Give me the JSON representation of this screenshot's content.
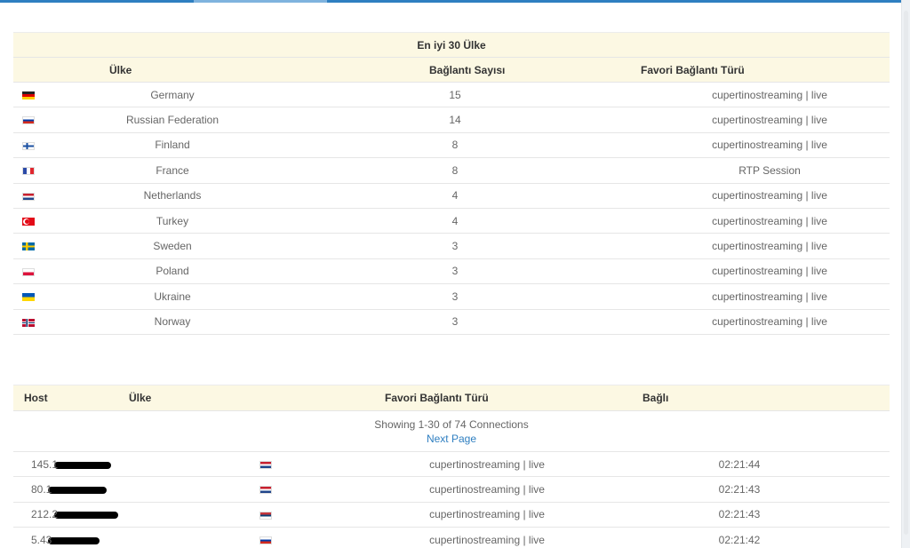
{
  "top_countries": {
    "caption": "En iyi 30 Ülke",
    "headers": {
      "country": "Ülke",
      "count": "Bağlantı Sayısı",
      "type": "Favori Bağlantı Türü"
    },
    "rows": [
      {
        "flag": "flag-germany-icon",
        "country": "Germany",
        "count": "15",
        "type": "cupertinostreaming | live"
      },
      {
        "flag": "flag-russia-icon",
        "country": "Russian Federation",
        "count": "14",
        "type": "cupertinostreaming | live"
      },
      {
        "flag": "flag-finland-icon",
        "country": "Finland",
        "count": "8",
        "type": "cupertinostreaming | live"
      },
      {
        "flag": "flag-france-icon",
        "country": "France",
        "count": "8",
        "type": "RTP Session"
      },
      {
        "flag": "flag-netherlands-icon",
        "country": "Netherlands",
        "count": "4",
        "type": "cupertinostreaming | live"
      },
      {
        "flag": "flag-turkey-icon",
        "country": "Turkey",
        "count": "4",
        "type": "cupertinostreaming | live"
      },
      {
        "flag": "flag-sweden-icon",
        "country": "Sweden",
        "count": "3",
        "type": "cupertinostreaming | live"
      },
      {
        "flag": "flag-poland-icon",
        "country": "Poland",
        "count": "3",
        "type": "cupertinostreaming | live"
      },
      {
        "flag": "flag-ukraine-icon",
        "country": "Ukraine",
        "count": "3",
        "type": "cupertinostreaming | live"
      },
      {
        "flag": "flag-norway-icon",
        "country": "Norway",
        "count": "3",
        "type": "cupertinostreaming | live"
      }
    ]
  },
  "connections": {
    "headers": {
      "host": "Host",
      "country": "Ülke",
      "type": "Favori Bağlantı Türü",
      "connected": "Bağlı"
    },
    "pager": {
      "showing": "Showing 1-30 of 74 Connections",
      "next": "Next Page"
    },
    "rows": [
      {
        "host": "145.1",
        "flag": "flag-netherlands-icon",
        "type": "cupertinostreaming | live",
        "connected": "02:21:44"
      },
      {
        "host": "80.1",
        "flag": "flag-netherlands-icon",
        "type": "cupertinostreaming | live",
        "connected": "02:21:43"
      },
      {
        "host": "212.2",
        "flag": "flag-serbia-icon",
        "type": "cupertinostreaming | live",
        "connected": "02:21:43"
      },
      {
        "host": "5.43",
        "flag": "flag-russia-icon",
        "type": "cupertinostreaming | live",
        "connected": "02:21:42"
      }
    ]
  },
  "colors": {
    "accent": "#2f7fc1",
    "header_bg": "#fcf8e3"
  }
}
